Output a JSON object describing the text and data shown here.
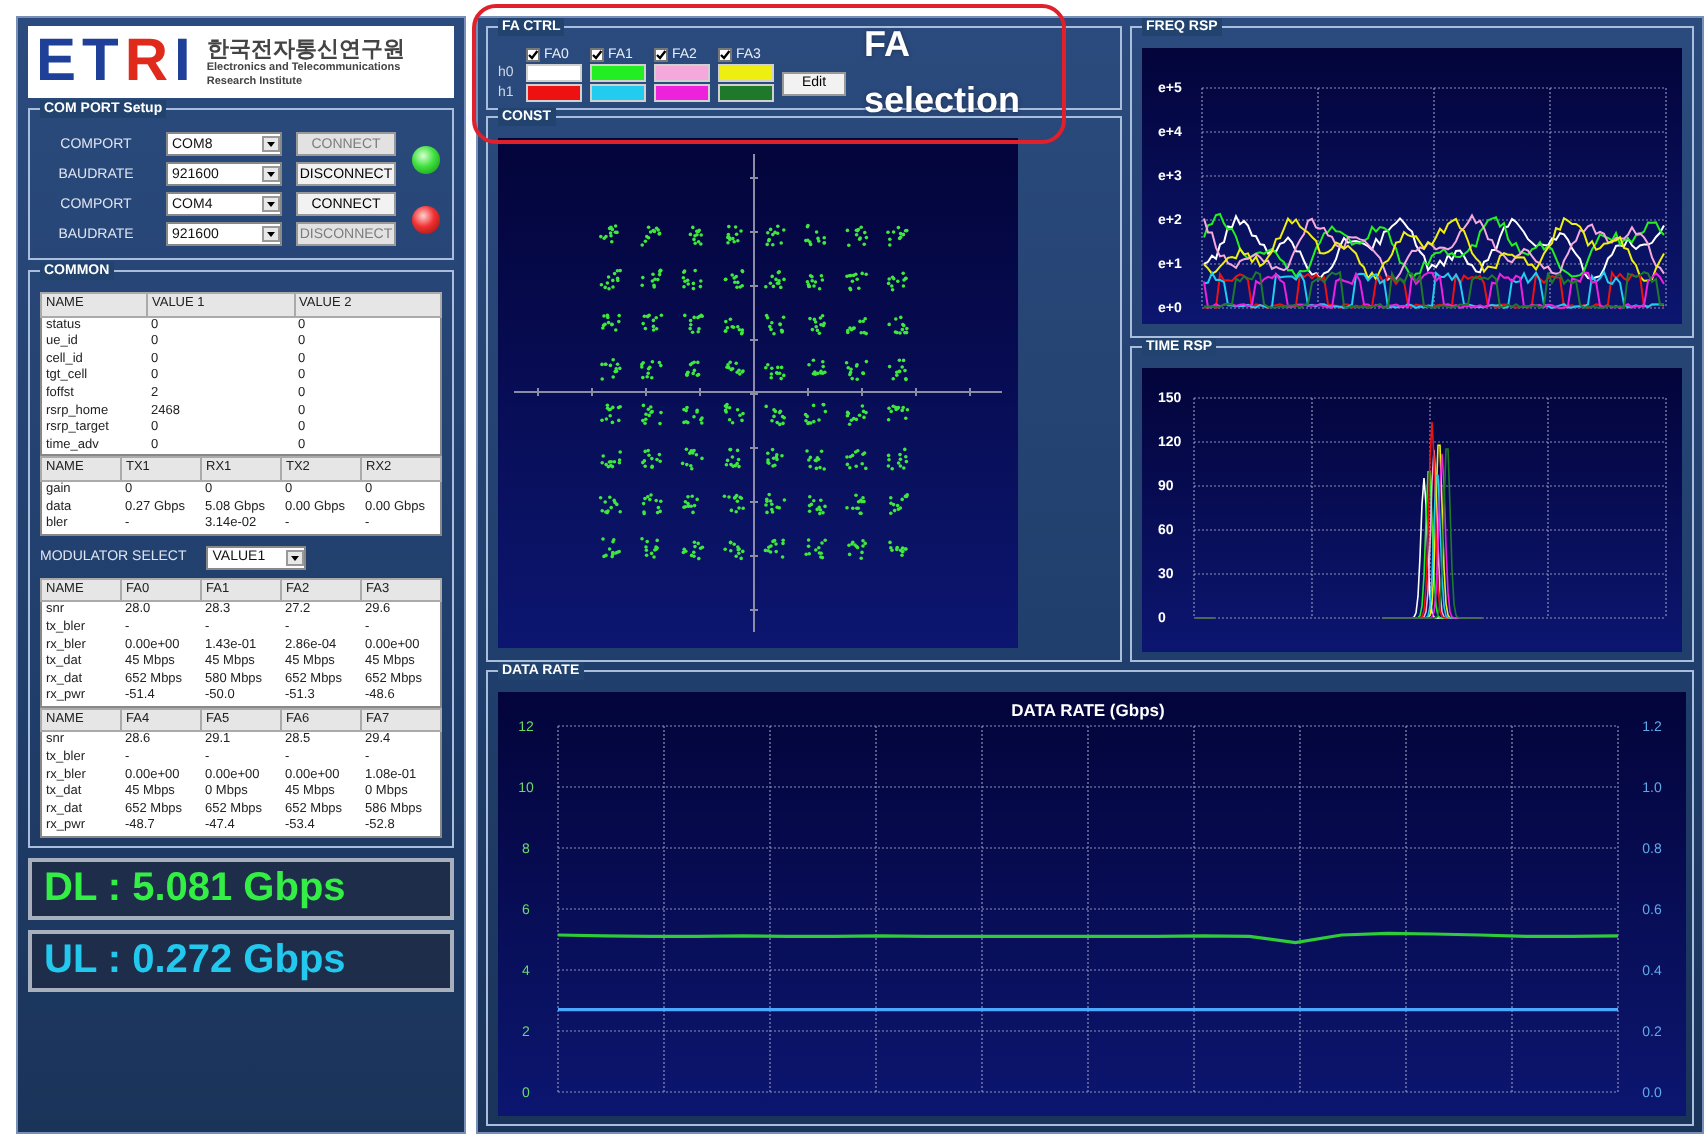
{
  "logo": {
    "letters": [
      {
        "text": "E",
        "color": "#1f4098"
      },
      {
        "text": "T",
        "color": "#1f4098"
      },
      {
        "text": "R",
        "color": "#e02a1c"
      },
      {
        "text": "I",
        "color": "#1f4098"
      }
    ],
    "korean": "한국전자통신연구원",
    "english": [
      "Electronics and Telecommunications",
      "Research Institute"
    ]
  },
  "com_port_setup": {
    "title": "COM PORT Setup",
    "ports": [
      {
        "comport_label": "COMPORT",
        "comport": "COM8",
        "baudrate_label": "BAUDRATE",
        "baudrate": "921600",
        "connect": {
          "label": "CONNECT",
          "disabled": true
        },
        "disconnect": {
          "label": "DISCONNECT",
          "disabled": false
        },
        "connected": true
      },
      {
        "comport_label": "COMPORT",
        "comport": "COM4",
        "baudrate_label": "BAUDRATE",
        "baudrate": "921600",
        "connect": {
          "label": "CONNECT",
          "disabled": false
        },
        "disconnect": {
          "label": "DISCONNECT",
          "disabled": true
        },
        "connected": false
      }
    ]
  },
  "common": {
    "title": "COMMON",
    "items": [
      {
        "kind": "table",
        "columns": [
          "NAME",
          "VALUE 1",
          "VALUE 2"
        ],
        "rows": [
          [
            "status",
            "0",
            "0"
          ],
          [
            "ue_id",
            "0",
            "0"
          ],
          [
            "cell_id",
            "0",
            "0"
          ],
          [
            "tgt_cell",
            "0",
            "0"
          ],
          [
            "foffst",
            "2",
            "0"
          ],
          [
            "rsrp_home",
            "2468",
            "0"
          ],
          [
            "rsrp_target",
            "0",
            "0"
          ],
          [
            "time_adv",
            "0",
            "0"
          ]
        ]
      },
      {
        "kind": "table",
        "columns": [
          "NAME",
          "TX1",
          "RX1",
          "TX2",
          "RX2"
        ],
        "rows": [
          [
            "gain",
            "0",
            "0",
            "0",
            "0"
          ],
          [
            "data",
            "0.27 Gbps",
            "5.08 Gbps",
            "0.00 Gbps",
            "0.00 Gbps"
          ],
          [
            "bler",
            "-",
            "3.14e-02",
            "-",
            "-"
          ]
        ]
      },
      {
        "kind": "select",
        "label": "MODULATOR SELECT",
        "value": "VALUE1"
      },
      {
        "kind": "table",
        "columns": [
          "NAME",
          "FA0",
          "FA1",
          "FA2",
          "FA3"
        ],
        "rows": [
          [
            "snr",
            "28.0",
            "28.3",
            "27.2",
            "29.6"
          ],
          [
            "tx_bler",
            "-",
            "-",
            "-",
            "-"
          ],
          [
            "rx_bler",
            "0.00e+00",
            "1.43e-01",
            "2.86e-04",
            "0.00e+00"
          ],
          [
            "tx_dat",
            "45 Mbps",
            "45 Mbps",
            "45 Mbps",
            "45 Mbps"
          ],
          [
            "rx_dat",
            "652 Mbps",
            "580 Mbps",
            "652 Mbps",
            "652 Mbps"
          ],
          [
            "rx_pwr",
            "-51.4",
            "-50.0",
            "-51.3",
            "-48.6"
          ]
        ]
      },
      {
        "kind": "table",
        "columns": [
          "NAME",
          "FA4",
          "FA5",
          "FA6",
          "FA7"
        ],
        "rows": [
          [
            "snr",
            "28.6",
            "29.1",
            "28.5",
            "29.4"
          ],
          [
            "tx_bler",
            "-",
            "-",
            "-",
            "-"
          ],
          [
            "rx_bler",
            "0.00e+00",
            "0.00e+00",
            "0.00e+00",
            "1.08e-01"
          ],
          [
            "tx_dat",
            "45 Mbps",
            "0 Mbps",
            "45 Mbps",
            "0 Mbps"
          ],
          [
            "rx_dat",
            "652 Mbps",
            "652 Mbps",
            "652 Mbps",
            "586 Mbps"
          ],
          [
            "rx_pwr",
            "-48.7",
            "-47.4",
            "-53.4",
            "-52.8"
          ]
        ]
      }
    ]
  },
  "rates": [
    {
      "text": "DL : 5.081 Gbps",
      "color": "#33ee44"
    },
    {
      "text": "UL : 0.272 Gbps",
      "color": "#22c8ee"
    }
  ],
  "fa_ctrl": {
    "title": "FA CTRL",
    "row_labels": [
      "h0",
      "h1"
    ],
    "edit_button": "Edit",
    "channels": [
      {
        "label": "FA0",
        "checked": true,
        "swatches": [
          {
            "color": "#ffffff"
          },
          {
            "color": "#ee1111"
          }
        ]
      },
      {
        "label": "FA1",
        "checked": true,
        "swatches": [
          {
            "color": "#22ee22"
          },
          {
            "color": "#22ccee"
          }
        ]
      },
      {
        "label": "FA2",
        "checked": true,
        "swatches": [
          {
            "color": "#f4a8dc"
          },
          {
            "color": "#ee22dd"
          }
        ]
      },
      {
        "label": "FA3",
        "checked": true,
        "swatches": [
          {
            "color": "#eeee11"
          },
          {
            "color": "#1e7a2a"
          }
        ]
      }
    ]
  },
  "const": {
    "title": "CONST"
  },
  "freq_rsp": {
    "title": "FREQ RSP",
    "y_labels": [
      "e+5",
      "e+4",
      "e+3",
      "e+2",
      "e+1",
      "e+0"
    ]
  },
  "time_rsp": {
    "title": "TIME RSP",
    "y_labels": [
      "150",
      "120",
      "90",
      "60",
      "30",
      "0"
    ]
  },
  "data_rate": {
    "title": "DATA RATE",
    "chart_data": {
      "type": "line",
      "title": "DATA RATE (Gbps)",
      "grid": true,
      "ylim": [
        0,
        12
      ],
      "yticks": [
        0,
        2,
        4,
        6,
        8,
        10,
        12
      ],
      "y2lim": [
        0,
        1.2
      ],
      "y2ticks": [
        {
          "value": 1.2,
          "label": "1.2"
        },
        {
          "value": 1.0,
          "label": "1.0"
        },
        {
          "value": 0.8,
          "label": "0.8"
        },
        {
          "value": 0.6,
          "label": "0.6"
        },
        {
          "value": 0.4,
          "label": "0.4"
        },
        {
          "value": 0.2,
          "label": "0.2"
        },
        {
          "value": 0,
          "label": "0.0"
        }
      ],
      "series": [
        {
          "color": "#2ecc3a",
          "values": [
            5.15,
            5.12,
            5.1,
            5.1,
            5.12,
            5.1,
            5.1,
            5.12,
            5.1,
            5.1,
            5.1,
            5.1,
            5.1,
            5.1,
            5.12,
            5.1,
            4.9,
            5.15,
            5.2,
            5.18,
            5.15,
            5.1,
            5.1,
            5.12
          ]
        },
        {
          "color": "#4aa8ff",
          "axis": "y2",
          "values": [
            0.27,
            0.27,
            0.27,
            0.27,
            0.27,
            0.27,
            0.27,
            0.27,
            0.27,
            0.27,
            0.27,
            0.27,
            0.27,
            0.27,
            0.27,
            0.27,
            0.27,
            0.27,
            0.27,
            0.27,
            0.27,
            0.27,
            0.27,
            0.27
          ]
        }
      ]
    }
  },
  "annotation": {
    "text": "FA selection"
  }
}
